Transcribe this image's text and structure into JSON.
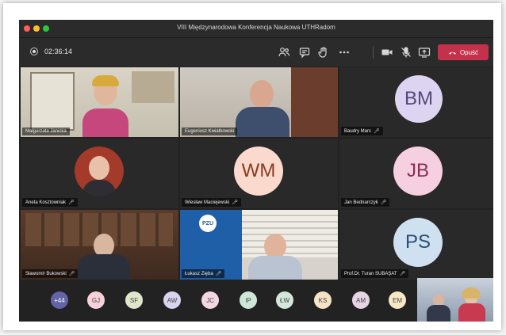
{
  "window": {
    "title": "VIII Międzynarodowa Konferencja Naukowa UTHRadom"
  },
  "toolbar": {
    "timer": "02:36:14",
    "leave_label": "Opuść",
    "icons": [
      "participants-icon",
      "chat-icon",
      "raise-hand-icon",
      "more-icon",
      "camera-icon",
      "mic-off-icon",
      "share-icon",
      "phone-hangup-icon"
    ]
  },
  "participants": [
    {
      "name": "Małgorzata Janicka",
      "type": "video"
    },
    {
      "name": "Eugeniusz Kwiatkowski",
      "type": "video"
    },
    {
      "name": "Baudry Marc",
      "type": "avatar",
      "initials": "BM",
      "color": "#dcd4f0",
      "text_color": "#55487a"
    },
    {
      "name": "Aneta Kosztowniak",
      "type": "photo"
    },
    {
      "name": "Wiesław Maciejewski",
      "type": "avatar",
      "initials": "WM",
      "color": "#fbd9cd",
      "text_color": "#8a3b22"
    },
    {
      "name": "Jan Bednarczyk",
      "type": "avatar",
      "initials": "JB",
      "color": "#f6cfe0",
      "text_color": "#8a2e59"
    },
    {
      "name": "Sławomir Bukowski",
      "type": "video"
    },
    {
      "name": "Łukasz Zięba",
      "type": "video"
    },
    {
      "name": "Prof.Dr. Turan SUBAŞAT",
      "type": "avatar",
      "initials": "PS",
      "color": "#cfe0f1",
      "text_color": "#2c4d73"
    }
  ],
  "more_participants": {
    "count": "+44",
    "avatars": [
      {
        "initials": "GJ",
        "color": "#f5d2d9"
      },
      {
        "initials": "SF",
        "color": "#dfe6c9"
      },
      {
        "initials": "AW",
        "color": "#d9d3ee"
      },
      {
        "initials": "JC",
        "color": "#f4d6e3"
      },
      {
        "initials": "IP",
        "color": "#cfe7d8"
      },
      {
        "initials": "ŁW",
        "color": "#d4e7db"
      },
      {
        "initials": "KS",
        "color": "#f6e3c6"
      },
      {
        "initials": "AM",
        "color": "#e7d3e6"
      },
      {
        "initials": "EM",
        "color": "#f7e9c4"
      }
    ]
  },
  "tile_logo": "PZU",
  "colors": {
    "leave": "#c4314b",
    "count_badge": "#6264a7"
  }
}
